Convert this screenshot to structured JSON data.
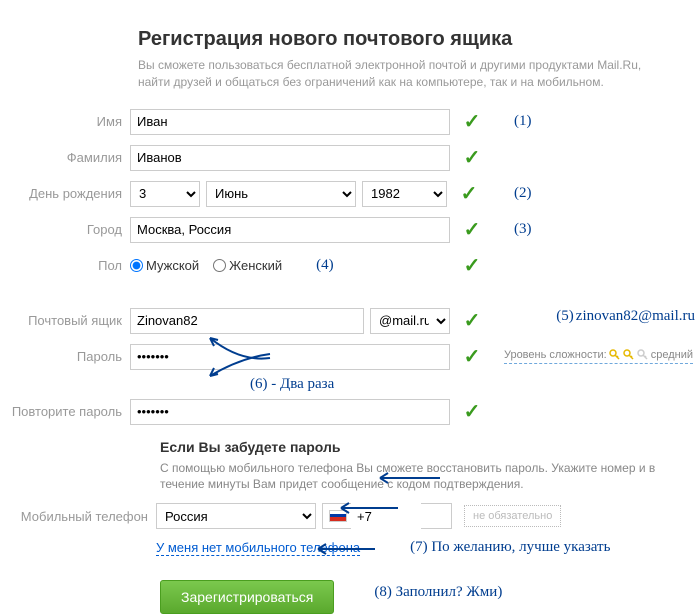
{
  "header": {
    "title": "Регистрация нового почтового ящика",
    "subtitle": "Вы сможете пользоваться бесплатной электронной почтой и другими продуктами Mail.Ru, найти друзей и общаться без ограничений как на компьютере, так и на мобильном."
  },
  "labels": {
    "name": "Имя",
    "surname": "Фамилия",
    "birthday": "День рождения",
    "city": "Город",
    "gender": "Пол",
    "mailbox": "Почтовый ящик",
    "password": "Пароль",
    "repeat_password": "Повторите пароль",
    "mobile": "Мобильный телефон"
  },
  "values": {
    "name": "Иван",
    "surname": "Иванов",
    "day": "3",
    "month": "Июнь",
    "year": "1982",
    "city": "Москва, Россия",
    "gender_male": "Мужской",
    "gender_female": "Женский",
    "mailbox": "Zinovan82",
    "domain": "@mail.ru",
    "password": "•••••••",
    "repeat_password": "•••••••",
    "country": "Россия",
    "phone_prefix": "+7"
  },
  "password_strength": {
    "label": "Уровень сложности:",
    "value": "средний"
  },
  "forgot": {
    "title": "Если Вы забудете пароль",
    "text": "С помощью мобильного телефона Вы сможете восстановить пароль. Укажите номер и в течение минуты Вам придет сообщение с кодом подтверждения."
  },
  "optional": "не обязательно",
  "link_no_phone": "У меня нет мобильного телефона",
  "button_register": "Зарегистрироваться",
  "annotations": {
    "a1": "(1)",
    "a2": "(2)",
    "a3": "(3)",
    "a4": "(4)",
    "a5": "(5)",
    "a5_email": "zinovan82@mail.ru",
    "a6": "(6) - Два раза",
    "a7": "(7) По желанию, лучше указать",
    "a8": "(8) Заполнил? Жми)"
  }
}
